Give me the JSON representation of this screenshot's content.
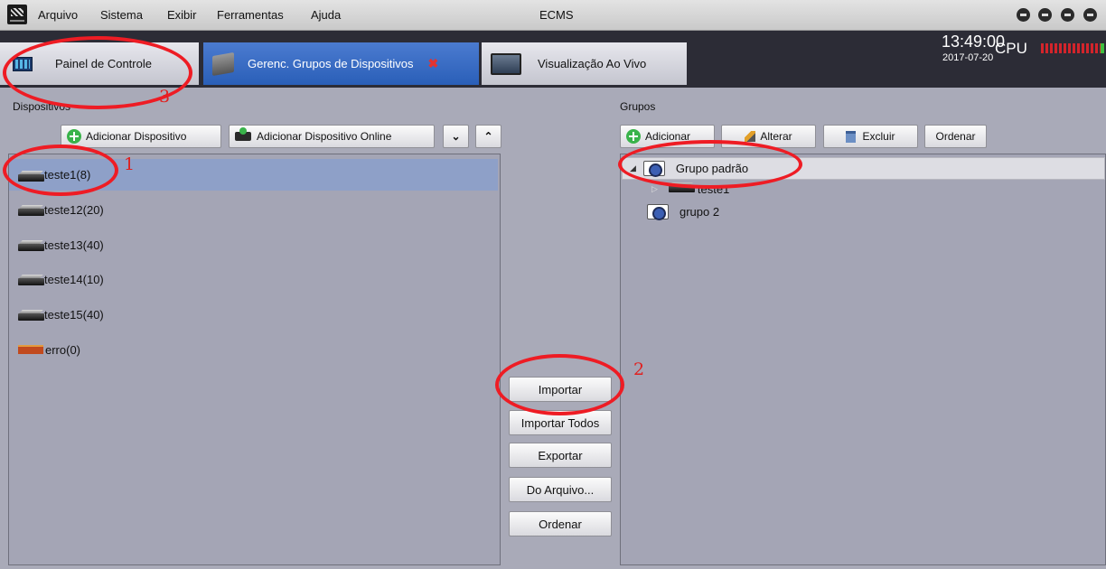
{
  "menubar": {
    "items": [
      "Arquivo",
      "Sistema",
      "Exibir",
      "Ferramentas",
      "Ajuda"
    ],
    "title": "ECMS"
  },
  "tabs": [
    {
      "label": "Painel de Controle",
      "icon": "control-panel-icon"
    },
    {
      "label": "Gerenc. Grupos de Dispositivos",
      "icon": "device-groups-icon",
      "active": true,
      "closable": true
    },
    {
      "label": "Visualização Ao Vivo",
      "icon": "monitor-icon"
    }
  ],
  "status": {
    "time": "13:49:00",
    "date": "2017-07-20",
    "cpu_label": "CPU"
  },
  "devices": {
    "title": "Dispositivos",
    "add_label": "Adicionar Dispositivo",
    "add_online_label": "Adicionar Dispositivo Online",
    "expand_glyph": "⌄",
    "collapse_glyph": "⌃",
    "items": [
      {
        "label": "teste1(8)",
        "type": "nvr",
        "selected": true
      },
      {
        "label": "teste12(20)",
        "type": "nvr"
      },
      {
        "label": "teste13(40)",
        "type": "nvr"
      },
      {
        "label": "teste14(10)",
        "type": "nvr"
      },
      {
        "label": "teste15(40)",
        "type": "nvr"
      },
      {
        "label": "erro(0)",
        "type": "error"
      }
    ]
  },
  "groups": {
    "title": "Grupos",
    "add_label": "Adicionar",
    "edit_label": "Alterar",
    "delete_label": "Excluir",
    "sort_label": "Ordenar",
    "tree": [
      {
        "label": "Grupo padrão",
        "expanded": true,
        "children": [
          {
            "label": "teste1"
          }
        ]
      },
      {
        "label": "grupo 2"
      }
    ]
  },
  "actions": {
    "import": "Importar",
    "import_all": "Importar Todos",
    "export": "Exportar",
    "from_file": "Do Arquivo...",
    "sort": "Ordenar"
  },
  "annotations": {
    "color": "#ee1c24",
    "labels": [
      "1",
      "2",
      "3"
    ]
  }
}
